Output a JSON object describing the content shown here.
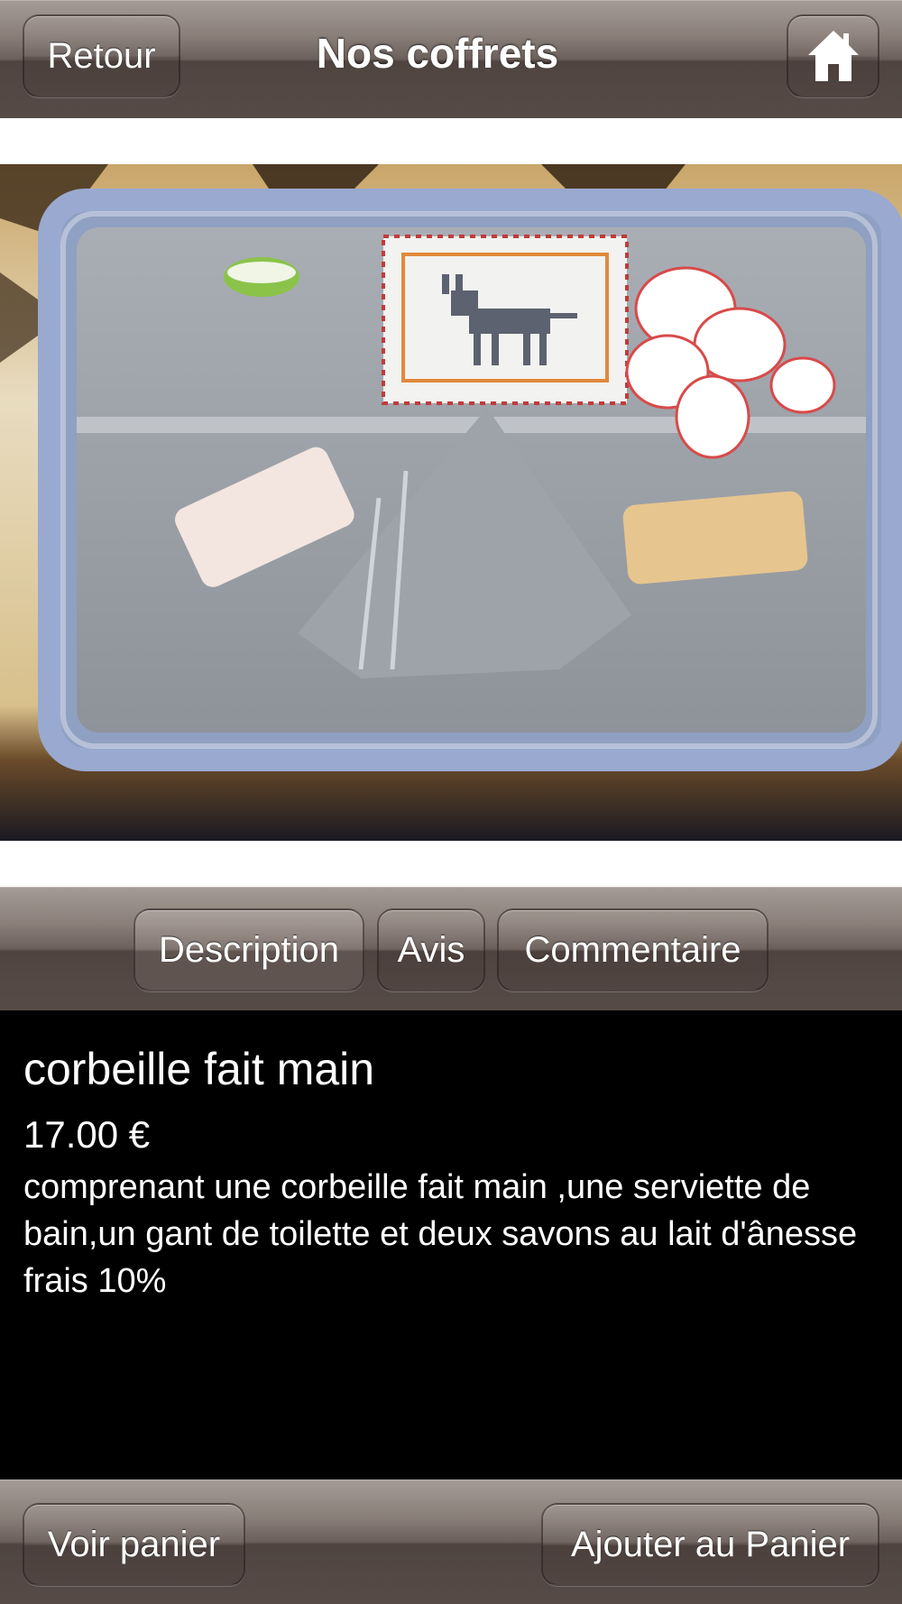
{
  "header": {
    "back_label": "Retour",
    "title": "Nos coffrets",
    "home_icon": "home-icon"
  },
  "tabs": [
    {
      "label": "Description",
      "selected": true
    },
    {
      "label": "Avis",
      "selected": false
    },
    {
      "label": "Commentaire",
      "selected": false
    }
  ],
  "product": {
    "name": "corbeille fait main",
    "price": "17.00 €",
    "description": "comprenant une corbeille fait main ,une serviette de bain,un gant de toilette et deux savons au lait d'ânesse frais 10%"
  },
  "footer": {
    "cart_label": "Voir panier",
    "add_label": "Ajouter au Panier"
  },
  "colors": {
    "bar": "#5a4f4a",
    "content_bg": "#000000",
    "text": "#ffffff"
  }
}
